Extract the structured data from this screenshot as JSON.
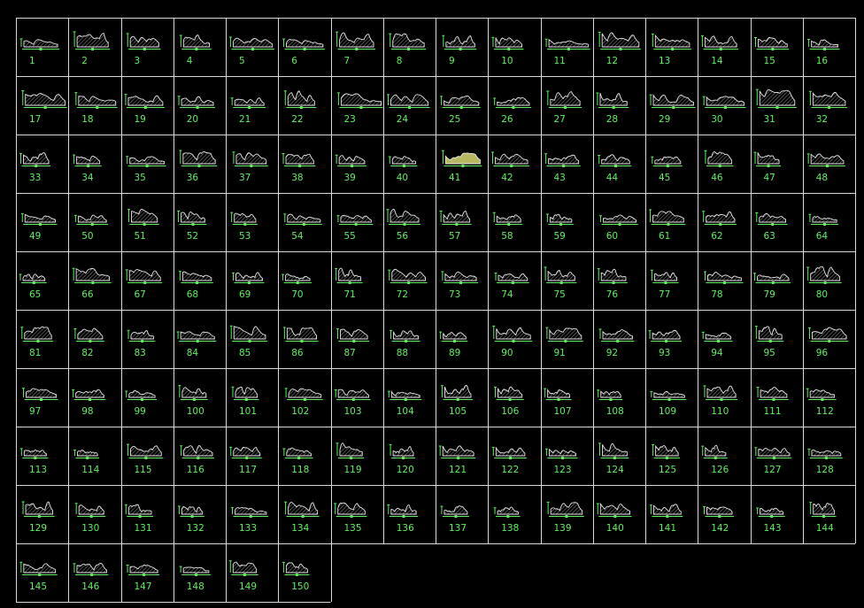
{
  "sheet": {
    "background": "#000000",
    "grid_color": "#d8d8d8",
    "label_color": "#5ef05e",
    "profile_color": "#e8e8e8",
    "rows": 10,
    "cols": 16,
    "item_count": 150
  },
  "items": [
    "1",
    "2",
    "3",
    "4",
    "5",
    "6",
    "7",
    "8",
    "9",
    "10",
    "11",
    "12",
    "13",
    "14",
    "15",
    "16",
    "17",
    "18",
    "19",
    "20",
    "21",
    "22",
    "23",
    "24",
    "25",
    "26",
    "27",
    "28",
    "29",
    "30",
    "31",
    "32",
    "33",
    "34",
    "35",
    "36",
    "37",
    "38",
    "39",
    "40",
    "41",
    "42",
    "43",
    "44",
    "45",
    "46",
    "47",
    "48",
    "49",
    "50",
    "51",
    "52",
    "53",
    "54",
    "55",
    "56",
    "57",
    "58",
    "59",
    "60",
    "61",
    "62",
    "63",
    "64",
    "65",
    "66",
    "67",
    "68",
    "69",
    "70",
    "71",
    "72",
    "73",
    "74",
    "75",
    "76",
    "77",
    "78",
    "79",
    "80",
    "81",
    "82",
    "83",
    "84",
    "85",
    "86",
    "87",
    "88",
    "89",
    "90",
    "91",
    "92",
    "93",
    "94",
    "95",
    "96",
    "97",
    "98",
    "99",
    "100",
    "101",
    "102",
    "103",
    "104",
    "105",
    "106",
    "107",
    "108",
    "109",
    "110",
    "111",
    "112",
    "113",
    "114",
    "115",
    "116",
    "117",
    "118",
    "119",
    "120",
    "121",
    "122",
    "123",
    "124",
    "125",
    "126",
    "127",
    "128",
    "129",
    "130",
    "131",
    "132",
    "133",
    "134",
    "135",
    "136",
    "137",
    "138",
    "139",
    "140",
    "141",
    "142",
    "143",
    "144",
    "145",
    "146",
    "147",
    "148",
    "149",
    "150"
  ]
}
